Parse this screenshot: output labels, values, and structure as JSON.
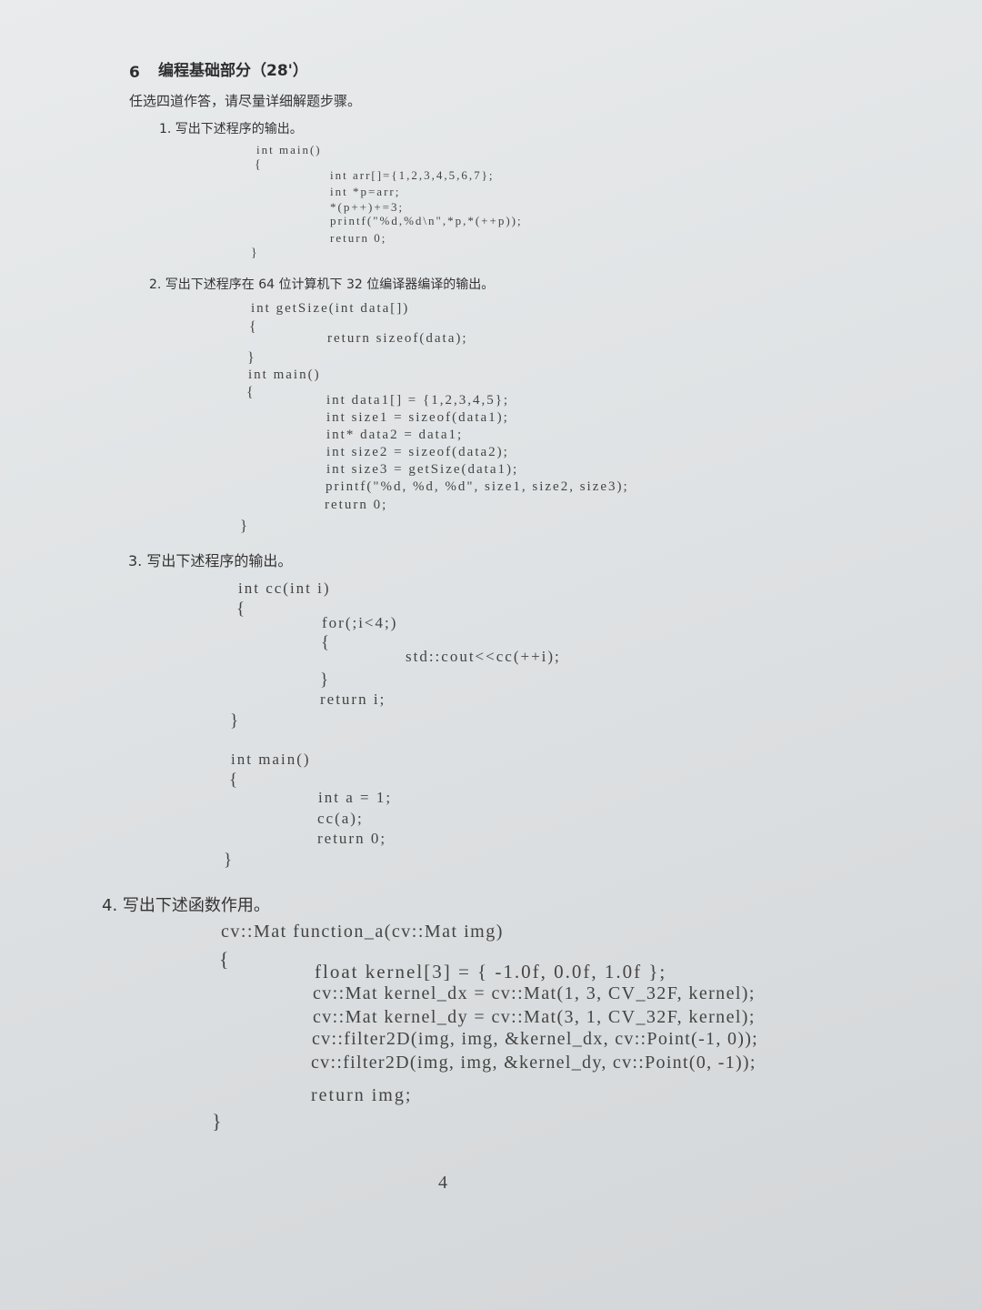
{
  "section": {
    "number": "6",
    "title": "编程基础部分（28'）",
    "instruction": "任选四道作答，请尽量详细解题步骤。"
  },
  "q1": {
    "prompt": "1. 写出下述程序的输出。",
    "lines": [
      "int main()",
      "{",
      "int arr[]={1,2,3,4,5,6,7};",
      "int *p=arr;",
      "*(p++)+=3;",
      "printf(\"%d,%d\\n\",*p,*(++p));",
      "return 0;",
      "}"
    ]
  },
  "q2": {
    "prompt": "2. 写出下述程序在 64 位计算机下 32 位编译器编译的输出。",
    "lines": [
      "int getSize(int data[])",
      "{",
      "return sizeof(data);",
      "}",
      "int main()",
      "{",
      "int data1[] = {1,2,3,4,5};",
      "int size1 = sizeof(data1);",
      "int* data2 = data1;",
      "int size2 = sizeof(data2);",
      "int size3 = getSize(data1);",
      "printf(\"%d, %d, %d\", size1, size2, size3);",
      "return 0;",
      "}"
    ]
  },
  "q3": {
    "prompt": "3. 写出下述程序的输出。",
    "lines": [
      "int cc(int i)",
      "{",
      "for(;i<4;)",
      "{",
      "std::cout<<cc(++i);",
      "}",
      "return i;",
      "}",
      "int main()",
      "{",
      "int a = 1;",
      "cc(a);",
      "return 0;",
      "}"
    ]
  },
  "q4": {
    "prompt": "4. 写出下述函数作用。",
    "lines": [
      "cv::Mat function_a(cv::Mat img)",
      "{",
      "float kernel[3] = { -1.0f, 0.0f, 1.0f };",
      "cv::Mat kernel_dx = cv::Mat(1, 3, CV_32F, kernel);",
      "cv::Mat kernel_dy = cv::Mat(3, 1, CV_32F, kernel);",
      "cv::filter2D(img, img, &kernel_dx, cv::Point(-1, 0));",
      "cv::filter2D(img, img, &kernel_dy, cv::Point(0, -1));",
      "return img;",
      "}"
    ]
  },
  "page_number": "4"
}
